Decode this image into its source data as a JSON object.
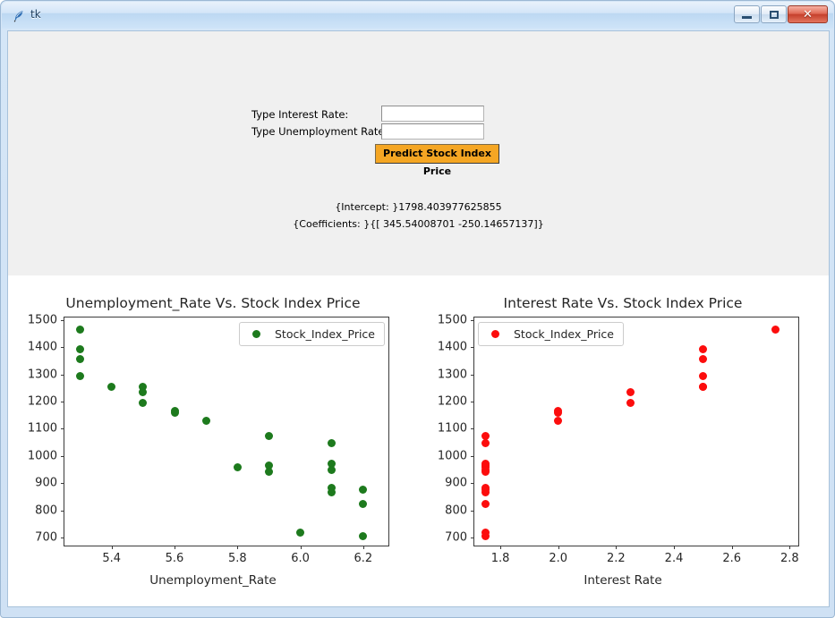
{
  "window": {
    "title": "tk",
    "icon": "feather-icon",
    "minimize_label": "–",
    "maximize_label": "❐",
    "close_label": "✕"
  },
  "form": {
    "interest_label": "Type Interest Rate:",
    "unemployment_label": "Type Unemployment Rate:",
    "interest_value": "",
    "unemployment_value": "",
    "interest_placeholder": "",
    "unemployment_placeholder": "",
    "predict_button": "Predict Stock Index Price"
  },
  "results": {
    "intercept": "{Intercept: }1798.403977625855",
    "coefficients": "{Coefficients: }{[ 345.54008701 -250.14657137]}"
  },
  "colors": {
    "accent_button": "#f5a623",
    "left_series": "#1d7a1d",
    "right_series": "#fc0d0d",
    "panel_bg": "#f0f0f0",
    "chart_bg": "#ffffff"
  },
  "chart_data": [
    {
      "id": "unemployment-chart",
      "type": "scatter",
      "title": "Unemployment_Rate Vs. Stock Index Price",
      "xlabel": "Unemployment_Rate",
      "ylabel": "",
      "legend": [
        "Stock_Index_Price"
      ],
      "legend_position": "upper right",
      "color": "#1d7a1d",
      "grid": false,
      "xlim": [
        5.25,
        6.28
      ],
      "ylim": [
        670,
        1510
      ],
      "xticks": [
        5.4,
        5.6,
        5.8,
        6.0,
        6.2
      ],
      "xtick_labels": [
        "5.4",
        "5.6",
        "5.8",
        "6.0",
        "6.2"
      ],
      "yticks": [
        700,
        800,
        900,
        1000,
        1100,
        1200,
        1300,
        1400,
        1500
      ],
      "ytick_labels": [
        "700",
        "800",
        "900",
        "1000",
        "1100",
        "1200",
        "1300",
        "1400",
        "1500"
      ],
      "x": [
        5.3,
        5.3,
        5.3,
        5.3,
        5.4,
        5.5,
        5.5,
        5.5,
        5.6,
        5.6,
        5.7,
        5.9,
        5.9,
        5.9,
        5.8,
        6.1,
        6.1,
        6.1,
        6.1,
        6.2,
        6.2,
        6.2,
        6.0,
        6.1
      ],
      "y": [
        1464,
        1394,
        1357,
        1293,
        1256,
        1254,
        1234,
        1195,
        1159,
        1167,
        1130,
        1075,
        965,
        943,
        958,
        971,
        949,
        884,
        866,
        876,
        822,
        704,
        719,
        1047
      ]
    },
    {
      "id": "interest-chart",
      "type": "scatter",
      "title": "Interest Rate Vs. Stock Index Price",
      "xlabel": "Interest Rate",
      "ylabel": "",
      "legend": [
        "Stock_Index_Price"
      ],
      "legend_position": "upper left",
      "color": "#fc0d0d",
      "grid": false,
      "xlim": [
        1.71,
        2.83
      ],
      "ylim": [
        670,
        1510
      ],
      "xticks": [
        1.8,
        2.0,
        2.2,
        2.4,
        2.6,
        2.8
      ],
      "xtick_labels": [
        "1.8",
        "2.0",
        "2.2",
        "2.4",
        "2.6",
        "2.8"
      ],
      "yticks": [
        700,
        800,
        900,
        1000,
        1100,
        1200,
        1300,
        1400,
        1500
      ],
      "ytick_labels": [
        "700",
        "800",
        "900",
        "1000",
        "1100",
        "1200",
        "1300",
        "1400",
        "1500"
      ],
      "x": [
        2.75,
        2.5,
        2.5,
        2.5,
        2.5,
        2.5,
        2.25,
        2.25,
        2.0,
        2.0,
        2.0,
        1.75,
        1.75,
        1.75,
        1.75,
        1.75,
        1.75,
        1.75,
        1.75,
        1.75,
        1.75,
        1.75,
        1.75,
        1.75
      ],
      "y": [
        1464,
        1394,
        1357,
        1293,
        1256,
        1254,
        1234,
        1195,
        1159,
        1167,
        1130,
        1075,
        1047,
        965,
        943,
        958,
        971,
        949,
        884,
        866,
        876,
        822,
        704,
        719
      ]
    }
  ]
}
